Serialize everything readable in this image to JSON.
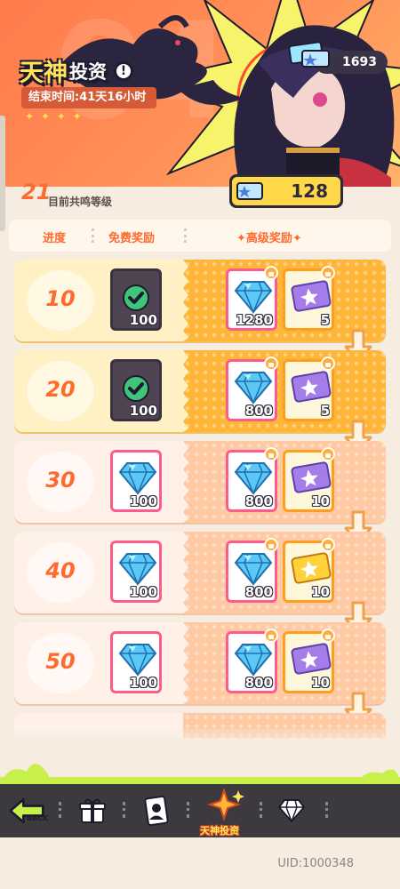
{
  "header": {
    "title_main": "天神",
    "title_sub": "投资",
    "info_icon": "info-icon",
    "end_time": "结束时间:41天16小时",
    "currency_value": "1693",
    "stars": "✦ ✦ ✦ ✦"
  },
  "level": {
    "current": "21",
    "label": "目前共鸣等级",
    "ticket_total": "128"
  },
  "columns": {
    "progress": "进度",
    "free": "免费奖励",
    "premium": "✦高级奖励✦"
  },
  "rows": [
    {
      "level": "10",
      "status": "claimed",
      "free": {
        "item": "diamond-icon",
        "qty": "100",
        "claimed": true
      },
      "premium": [
        {
          "item": "diamond-icon",
          "qty": "1280"
        },
        {
          "item": "purple-ticket-icon",
          "qty": "5"
        }
      ]
    },
    {
      "level": "20",
      "status": "claimed",
      "free": {
        "item": "diamond-icon",
        "qty": "100",
        "claimed": true
      },
      "premium": [
        {
          "item": "diamond-icon",
          "qty": "800"
        },
        {
          "item": "purple-ticket-icon",
          "qty": "5"
        }
      ]
    },
    {
      "level": "30",
      "status": "locked",
      "free": {
        "item": "diamond-icon",
        "qty": "100",
        "claimed": false
      },
      "premium": [
        {
          "item": "diamond-icon",
          "qty": "800"
        },
        {
          "item": "purple-ticket-icon",
          "qty": "10"
        }
      ]
    },
    {
      "level": "40",
      "status": "locked",
      "free": {
        "item": "diamond-icon",
        "qty": "100",
        "claimed": false
      },
      "premium": [
        {
          "item": "diamond-icon",
          "qty": "800"
        },
        {
          "item": "gold-ticket-icon",
          "qty": "10"
        }
      ]
    },
    {
      "level": "50",
      "status": "locked",
      "free": {
        "item": "diamond-icon",
        "qty": "100",
        "claimed": false
      },
      "premium": [
        {
          "item": "diamond-icon",
          "qty": "800"
        },
        {
          "item": "purple-ticket-icon",
          "qty": "10"
        }
      ]
    }
  ],
  "nav": {
    "back_label": "BACK",
    "active_label": "天神投资",
    "items": [
      "back-arrow-icon",
      "gift-icon",
      "card-icon",
      "sparkle-icon",
      "diamond-shop-icon"
    ]
  },
  "footer": {
    "uid": "UID:1000348"
  },
  "colors": {
    "accent_orange": "#ff6a2e",
    "lime": "#c7f04b",
    "dark": "#3d3a3f",
    "gold": "#ffb638"
  }
}
